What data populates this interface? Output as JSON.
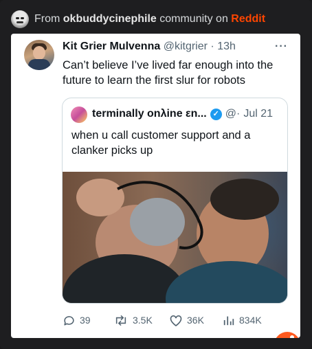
{
  "header": {
    "prefix": "From",
    "community": "okbuddycinephile",
    "middle": "community on",
    "platform": "Reddit"
  },
  "tweet": {
    "author_name": "Kit Grier Mulvenna",
    "handle": "@kitgrier",
    "separator": "·",
    "time": "13h",
    "more": "···",
    "text": "Can’t believe I’ve lived far enough into the future to learn the first slur for robots"
  },
  "quote": {
    "author_name": "terminally onλine εn...",
    "handle": "@·",
    "date": "Jul 21",
    "verified_mark": "✓",
    "text": "when u call customer support and a clanker picks up"
  },
  "actions": {
    "replies": "39",
    "retweets": "3.5K",
    "likes": "36K",
    "views": "834K"
  },
  "colors": {
    "reddit_accent": "#ff4500",
    "verified_blue": "#1d9bf0",
    "muted_text": "#536471"
  }
}
